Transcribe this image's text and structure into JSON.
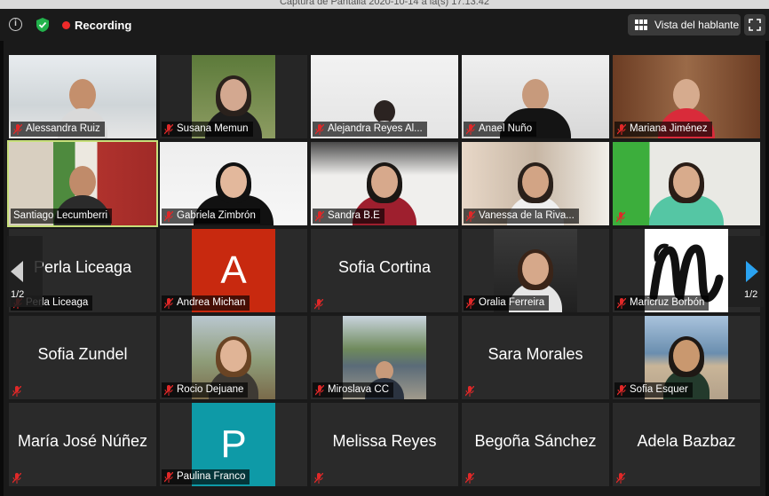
{
  "window": {
    "title": "Captura de Pantalla 2020-10-14 a la(s) 17.13.42"
  },
  "toolbar": {
    "info_icon": "info-icon",
    "security_icon": "shield-check-icon",
    "recording_label": "Recording",
    "view_label": "Vista del hablante",
    "fullscreen_icon": "fullscreen-icon"
  },
  "colors": {
    "active_speaker_border": "#c7df7a",
    "recording_red": "#ee2a2a",
    "page_arrow_blue": "#2aa2f0",
    "muted_mic": "#e02828"
  },
  "pager": {
    "left_label": "1/2",
    "right_label": "1/2"
  },
  "participants": [
    {
      "name": "Alessandra Ruiz",
      "mode": "video"
    },
    {
      "name": "Susana Memun",
      "mode": "video"
    },
    {
      "name": "Alejandra Reyes Al...",
      "mode": "video"
    },
    {
      "name": "Anael Nuño",
      "mode": "video"
    },
    {
      "name": "Mariana Jiménez",
      "mode": "video"
    },
    {
      "name": "Santiago Lecumberri",
      "mode": "video",
      "active_speaker": true
    },
    {
      "name": "Gabriela Zimbrón",
      "mode": "video"
    },
    {
      "name": "Sandra B.E",
      "mode": "video"
    },
    {
      "name": "Vanessa de la Riva...",
      "mode": "video"
    },
    {
      "name": "",
      "mode": "video"
    },
    {
      "name": "Perla Liceaga",
      "display": "Perla Liceaga",
      "mode": "name"
    },
    {
      "name": "Andrea Michan",
      "mode": "avatar",
      "letter": "A",
      "color": "#c8290f"
    },
    {
      "name": "",
      "display": "Sofia Cortina",
      "mode": "name"
    },
    {
      "name": "Oralia Ferreira",
      "mode": "photo"
    },
    {
      "name": "Maricruz Borbón",
      "mode": "photo",
      "photo": "letter-m"
    },
    {
      "name": "",
      "display": "Sofia Zundel",
      "mode": "name"
    },
    {
      "name": "Rocio Dejuane",
      "mode": "photo"
    },
    {
      "name": "Miroslava CC",
      "mode": "photo"
    },
    {
      "name": "",
      "display": "Sara Morales",
      "mode": "name"
    },
    {
      "name": "Sofia Esquer",
      "mode": "photo"
    },
    {
      "name": "",
      "display": "María José Núñez",
      "mode": "name"
    },
    {
      "name": "Paulina Franco",
      "mode": "avatar",
      "letter": "P",
      "color": "#0e9aa7"
    },
    {
      "name": "",
      "display": "Melissa Reyes",
      "mode": "name"
    },
    {
      "name": "",
      "display": "Begoña Sánchez",
      "mode": "name"
    },
    {
      "name": "",
      "display": "Adela Bazbaz",
      "mode": "name"
    }
  ]
}
